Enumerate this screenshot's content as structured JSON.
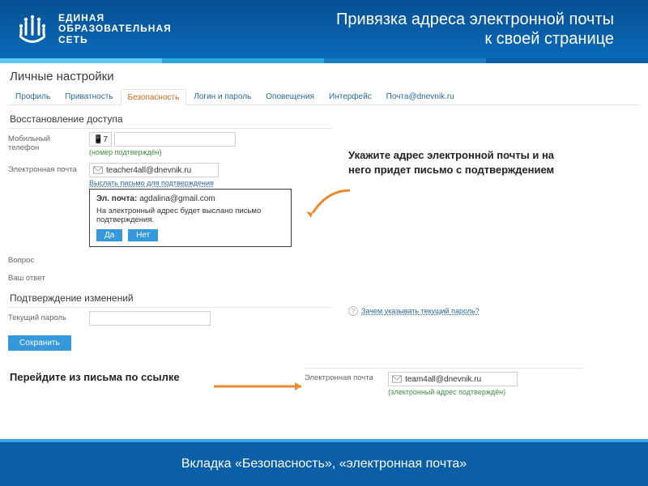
{
  "brand": {
    "line1": "ЕДИНАЯ",
    "line2": "ОБРАЗОВАТЕЛЬНАЯ",
    "line3": "СЕТЬ"
  },
  "slide_title_l1": "Привязка адреса электронной почты",
  "slide_title_l2": "к своей странице",
  "page_title": "Личные настройки",
  "tabs": {
    "profile": "Профиль",
    "privacy": "Приватность",
    "security": "Безопасность",
    "login": "Логин и пароль",
    "alerts": "Оповещения",
    "iface": "Интерфейс",
    "mail": "Почта@dnevnik.ru"
  },
  "sections": {
    "restore": "Восстановление доступа",
    "confirm_changes": "Подтверждение изменений"
  },
  "fields": {
    "phone_label": "Мобильный телефон",
    "phone_prefix": "7",
    "phone_value": "",
    "phone_hint": "(номер подтверждён)",
    "email_label": "Электронная почта",
    "email_value": "teacher4all@dnevnik.ru",
    "email_link": "Выслать письмо для подтверждения",
    "question_label": "Вопрос",
    "answer_label": "Ваш ответ",
    "cur_pwd_label": "Текущий пароль"
  },
  "confirm_box": {
    "line1_label": "Эл. почта:",
    "line1_value": "agdalina@gmail.com",
    "line2": "На электронный адрес будет выслано письмо подтверждения.",
    "yes": "Да",
    "no": "Нет"
  },
  "help_link": "Зачем указывать текущий пароль?",
  "save_btn": "Сохранить",
  "callout1": "Укажите адрес электронной почты и на него придет письмо с подтверждением",
  "callout2": "Перейдите из письма по ссылке",
  "snippet": {
    "label": "Электронная почта",
    "value": "team4all@dnevnik.ru",
    "hint": "(электронный адрес подтверждён)"
  },
  "footer": "Вкладка «Безопасность», «электронная почта»"
}
